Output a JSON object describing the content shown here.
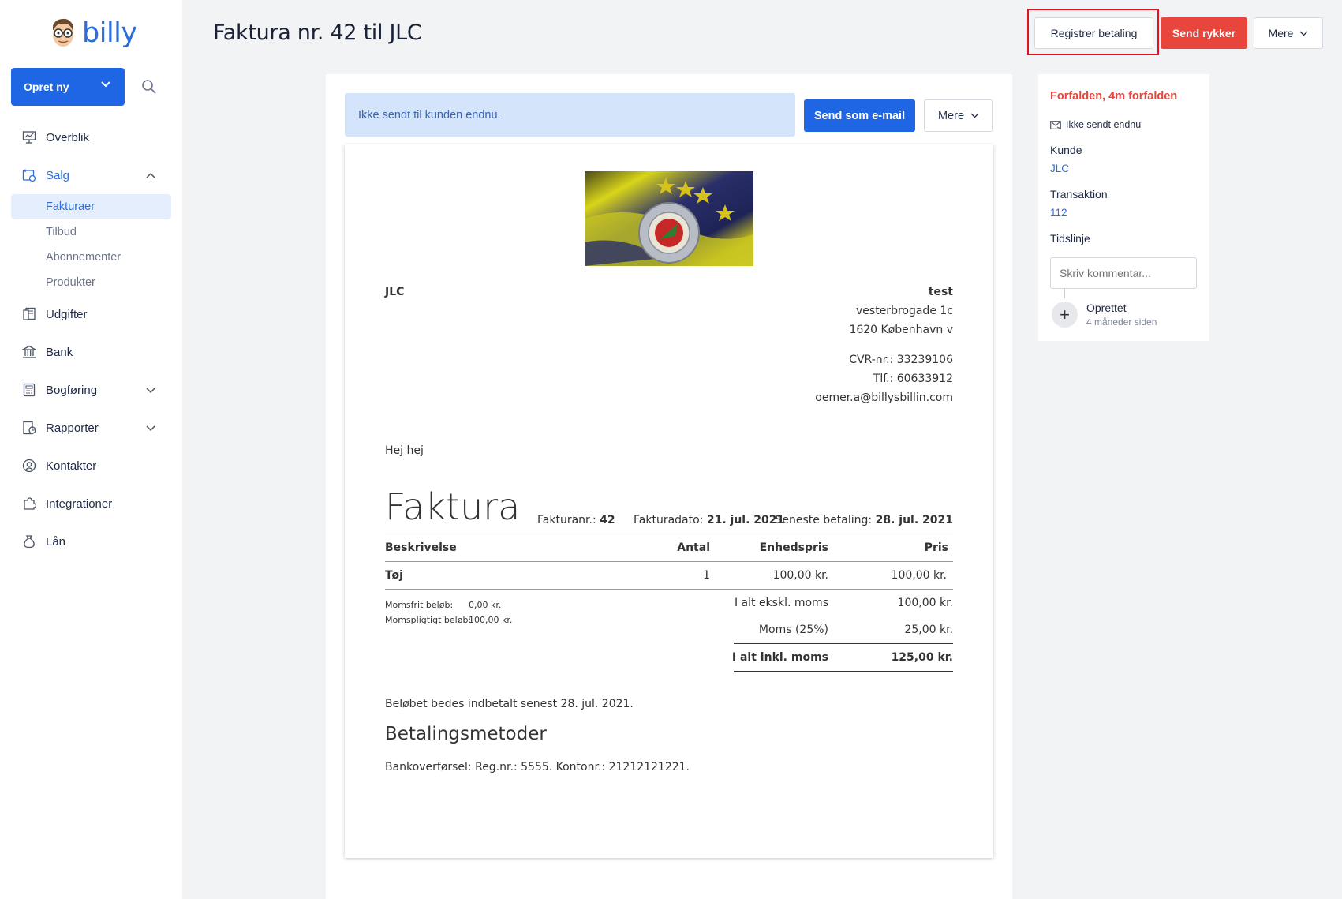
{
  "app": {
    "logo_text": "billy"
  },
  "sidebar": {
    "create_label": "Opret ny",
    "items": [
      {
        "label": "Overblik"
      },
      {
        "label": "Salg"
      },
      {
        "label": "Udgifter"
      },
      {
        "label": "Bank"
      },
      {
        "label": "Bogføring"
      },
      {
        "label": "Rapporter"
      },
      {
        "label": "Kontakter"
      },
      {
        "label": "Integrationer"
      },
      {
        "label": "Lån"
      }
    ],
    "salg_sub": [
      {
        "label": "Fakturaer"
      },
      {
        "label": "Tilbud"
      },
      {
        "label": "Abonnementer"
      },
      {
        "label": "Produkter"
      }
    ]
  },
  "header": {
    "title": "Faktura nr. 42 til JLC",
    "register_payment": "Registrer betaling",
    "send_reminder": "Send rykker",
    "more": "Mere"
  },
  "notice": {
    "text": "Ikke sendt til kunden endnu.",
    "send_email": "Send som e-mail",
    "more": "Mere"
  },
  "invoice": {
    "customer": "JLC",
    "company_name": "test",
    "address1": "vesterbrogade 1c",
    "address2": "1620 København v",
    "cvr": "CVR-nr.: 33239106",
    "phone": "Tlf.: 60633912",
    "email": "oemer.a@billysbillin.com",
    "greeting": "Hej hej",
    "heading": "Faktura",
    "number_label": "Fakturanr.:",
    "number": "42",
    "date_label": "Fakturadato:",
    "date": "21. jul. 2021",
    "due_label": "Seneste betaling:",
    "due": "28. jul. 2021",
    "columns": {
      "desc": "Beskrivelse",
      "qty": "Antal",
      "unit_price": "Enhedspris",
      "price": "Pris"
    },
    "lines": [
      {
        "desc": "Tøj",
        "qty": "1",
        "unit_price": "100,00 kr.",
        "price": "100,00 kr."
      }
    ],
    "vat_free_label": "Momsfrit beløb:",
    "vat_free_value": "0,00 kr.",
    "vat_liable_label": "Momspligtigt beløb:",
    "vat_liable_value": "100,00 kr.",
    "subtotal_label": "I alt ekskl. moms",
    "subtotal": "100,00 kr.",
    "vat_label": "Moms (25%)",
    "vat": "25,00 kr.",
    "total_label": "I alt inkl. moms",
    "total": "125,00 kr.",
    "payment_note": "Beløbet bedes indbetalt senest 28. jul. 2021.",
    "payment_methods_heading": "Betalingsmetoder",
    "bank_transfer": "Bankoverførsel: Reg.nr.: 5555. Kontonr.: 21212121221."
  },
  "side_panel": {
    "status": "Forfalden, 4m forfalden",
    "sent_status": "Ikke sendt endnu",
    "customer_label": "Kunde",
    "customer": "JLC",
    "transaction_label": "Transaktion",
    "transaction": "112",
    "timeline_label": "Tidslinje",
    "comment_placeholder": "Skriv kommentar...",
    "event_title": "Oprettet",
    "event_time": "4 måneder siden"
  },
  "colors": {
    "primary": "#1f66e5",
    "danger": "#e8453c",
    "highlight": "#e0141e"
  }
}
